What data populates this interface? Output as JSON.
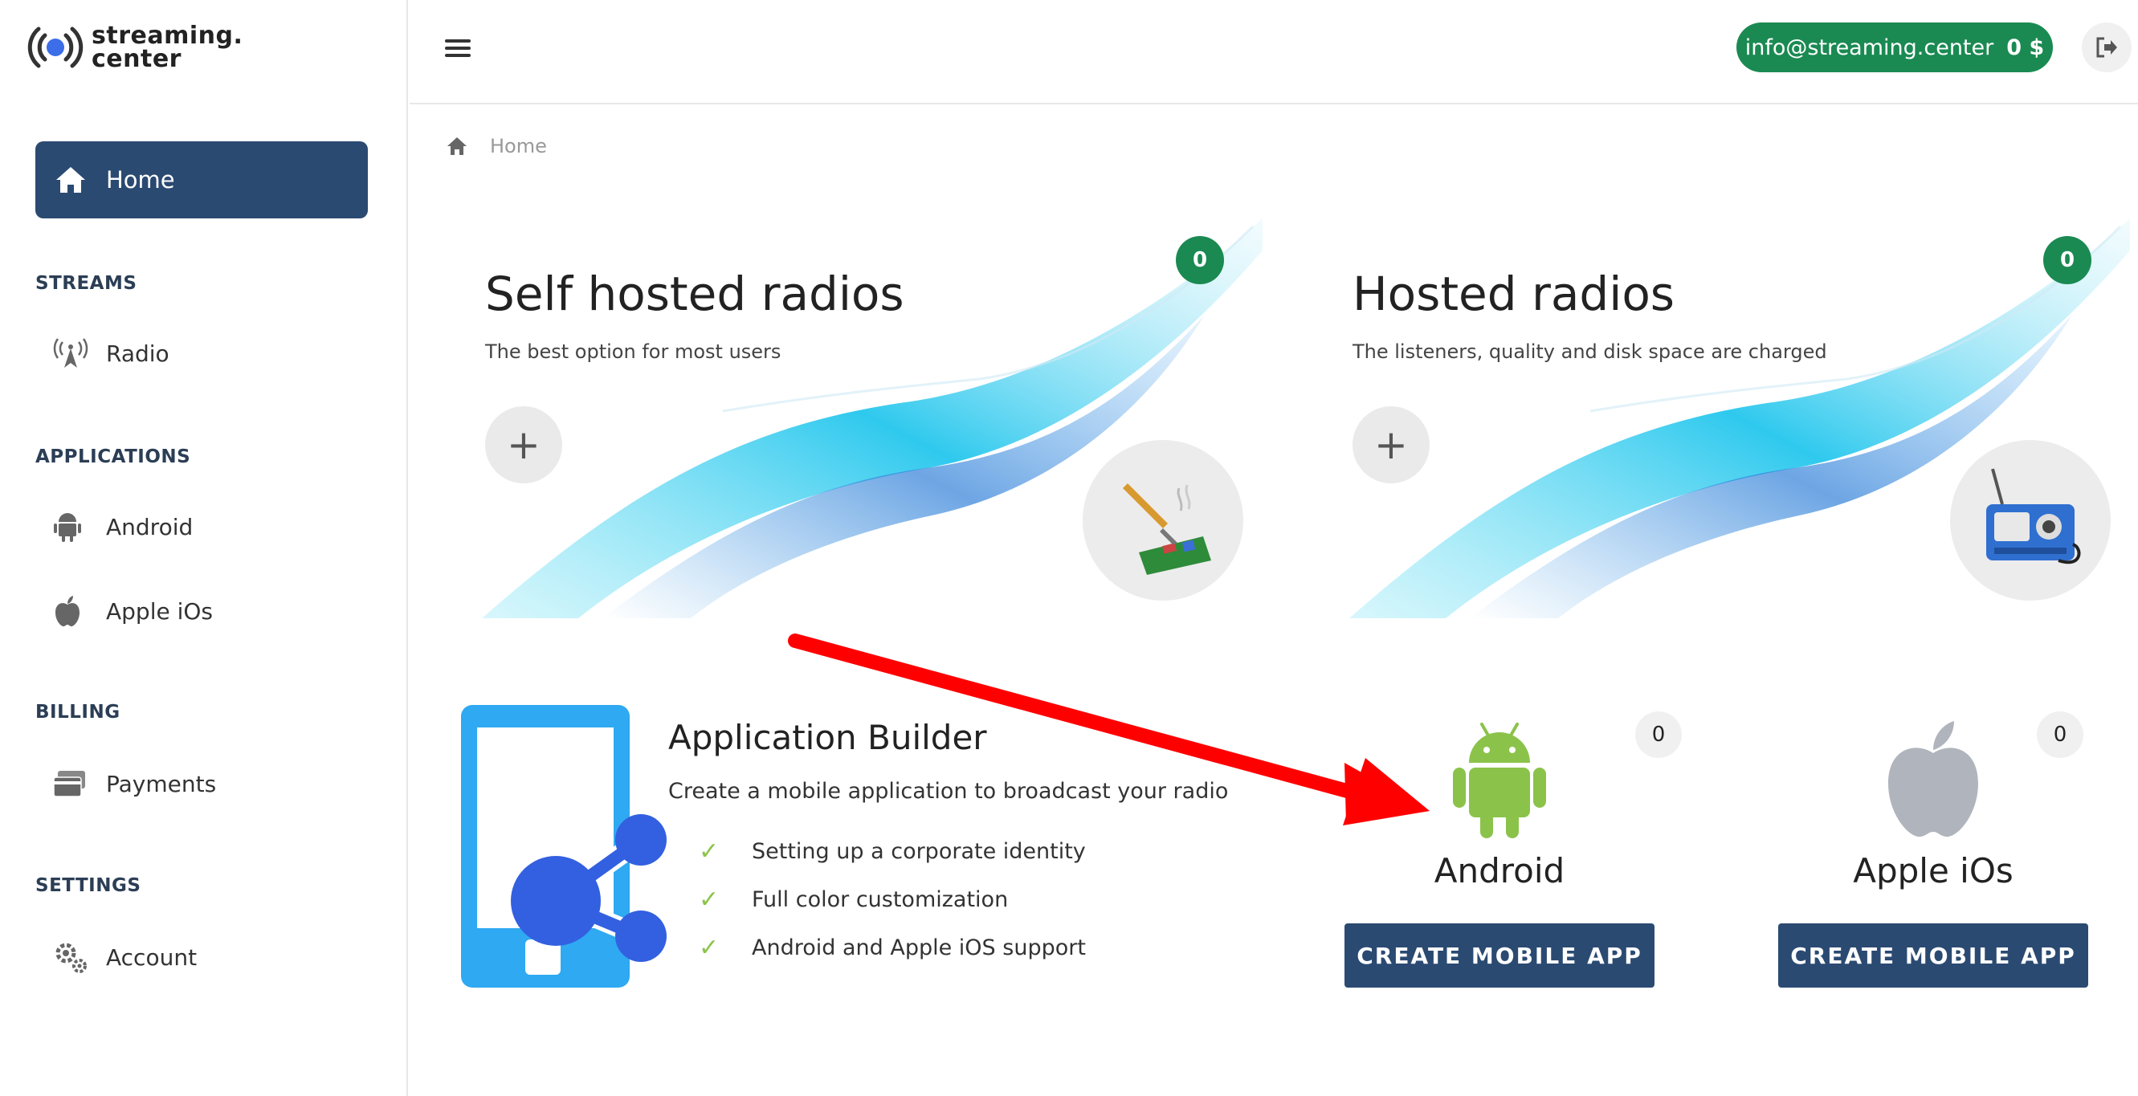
{
  "brand": {
    "line1": "streaming.",
    "line2": "center"
  },
  "sidebar": {
    "home": {
      "label": "Home"
    },
    "sections": [
      {
        "title": "STREAMS",
        "items": [
          {
            "label": "Radio",
            "icon": "radio-tower-icon"
          }
        ]
      },
      {
        "title": "APPLICATIONS",
        "items": [
          {
            "label": "Android",
            "icon": "android-icon"
          },
          {
            "label": "Apple iOs",
            "icon": "apple-icon"
          }
        ]
      },
      {
        "title": "BILLING",
        "items": [
          {
            "label": "Payments",
            "icon": "credit-card-icon"
          }
        ]
      },
      {
        "title": "SETTINGS",
        "items": [
          {
            "label": "Account",
            "icon": "gears-icon"
          }
        ]
      }
    ]
  },
  "header": {
    "email": "info@streaming.center",
    "balance": "0 $"
  },
  "breadcrumb": {
    "label": "Home"
  },
  "cards": [
    {
      "title": "Self hosted radios",
      "subtitle": "The best option for most users",
      "count": "0",
      "add": "+"
    },
    {
      "title": "Hosted radios",
      "subtitle": "The listeners, quality and disk space are charged",
      "count": "0",
      "add": "+"
    }
  ],
  "app_builder": {
    "title": "Application Builder",
    "subtitle": "Create a mobile application to broadcast your radio",
    "features": [
      "Setting up a corporate identity",
      "Full color customization",
      "Android and Apple iOS support"
    ]
  },
  "platforms": [
    {
      "name": "Android",
      "count": "0",
      "button": "CREATE MOBILE APP"
    },
    {
      "name": "Apple iOs",
      "count": "0",
      "button": "CREATE MOBILE APP"
    }
  ],
  "colors": {
    "primary": "#2b4a72",
    "success": "#1a8a52",
    "check": "#8bc34a",
    "android": "#8bc34a",
    "apple": "#b0b5bd",
    "arrow": "#ff0000"
  }
}
